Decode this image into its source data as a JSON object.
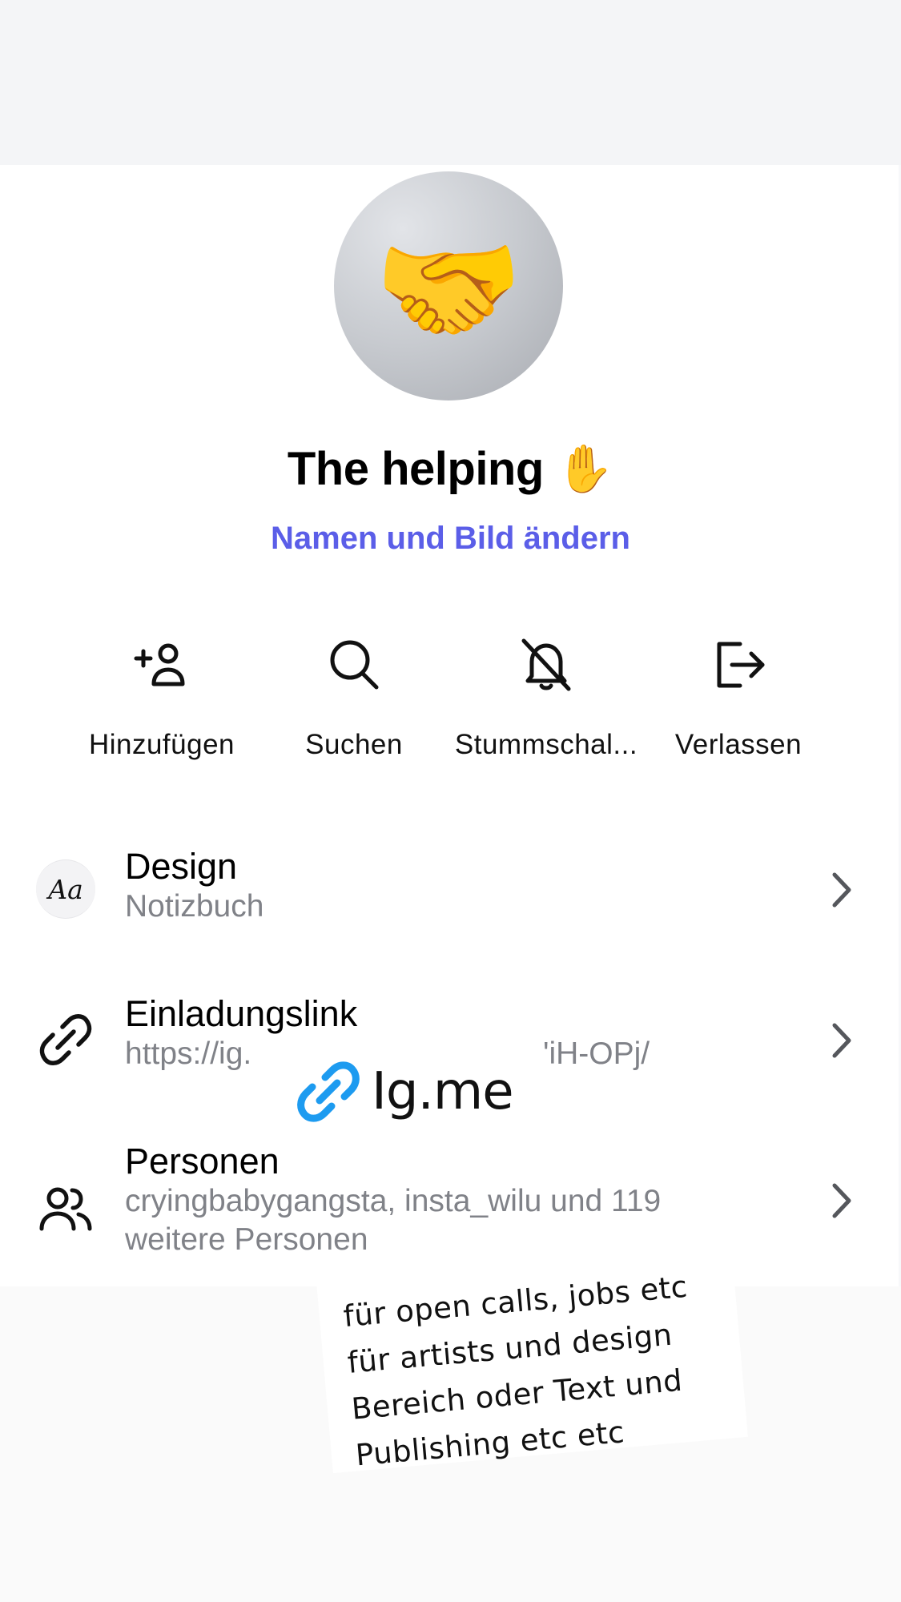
{
  "group": {
    "avatar_emoji": "🤝",
    "name": "The helping ✋",
    "edit_link": "Namen und Bild ändern"
  },
  "actions": [
    {
      "label": "Hinzufügen",
      "icon": "add-person-icon"
    },
    {
      "label": "Suchen",
      "icon": "search-icon"
    },
    {
      "label": "Stummschal...",
      "icon": "bell-muted-icon"
    },
    {
      "label": "Verlassen",
      "icon": "leave-icon"
    }
  ],
  "settings": {
    "design": {
      "title": "Design",
      "subtitle": "Notizbuch",
      "icon_text": "Aa",
      "icon": "theme-icon"
    },
    "invite": {
      "title": "Einladungslink",
      "subtitle_left": "https://ig.",
      "subtitle_right": "'iH-OPj/",
      "icon": "link-icon"
    },
    "people": {
      "title": "Personen",
      "subtitle_line1": "cryingbabygangsta, insta_wilu und 119",
      "subtitle_line2": "weitere Personen",
      "icon": "people-icon"
    }
  },
  "sticker": {
    "text": "Ig.me",
    "icon": "link-sticker-icon"
  },
  "note": {
    "lines": [
      "für open calls, jobs etc",
      "für artists und design",
      "Bereich oder Text und",
      "Publishing etc etc"
    ]
  },
  "colors": {
    "accent": "#5b5ee8",
    "subtext": "#808288",
    "sticker_blue": "#1d9bf0"
  }
}
